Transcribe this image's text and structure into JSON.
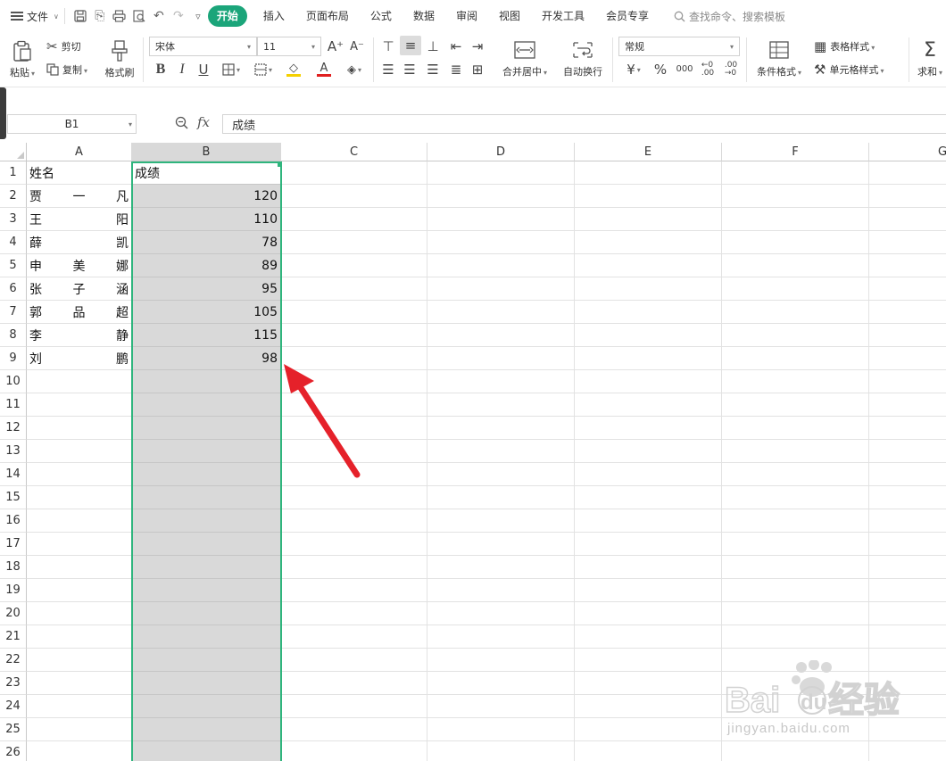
{
  "menubar": {
    "file_label": "文件",
    "tabs": [
      "开始",
      "插入",
      "页面布局",
      "公式",
      "数据",
      "审阅",
      "视图",
      "开发工具",
      "会员专享"
    ],
    "active_tab": "开始",
    "search_placeholder": "查找命令、搜索模板"
  },
  "ribbon": {
    "paste": "粘贴",
    "cut": "剪切",
    "copy": "复制",
    "format_painter": "格式刷",
    "font_name": "宋体",
    "font_size": "11",
    "merge_center": "合并居中",
    "wrap_text": "自动换行",
    "number_format": "常规",
    "conditional_format": "条件格式",
    "table_style": "表格样式",
    "cell_style": "单元格样式",
    "sum": "求和",
    "font_color": "#e02020",
    "fill_color": "#f5d000",
    "brand_color": "#1ba57a"
  },
  "formula_bar": {
    "name_box": "B1",
    "fx": "fx",
    "content": "成绩"
  },
  "sheet": {
    "columns": [
      "A",
      "B",
      "C",
      "D",
      "E",
      "F",
      "G"
    ],
    "selected_column": "B",
    "rows": [
      "1",
      "2",
      "3",
      "4",
      "5",
      "6",
      "7",
      "8",
      "9",
      "10",
      "11",
      "12",
      "13",
      "14",
      "15",
      "16",
      "17",
      "18",
      "19",
      "20",
      "21",
      "22",
      "23",
      "24",
      "25",
      "26"
    ],
    "header": {
      "name": "姓名",
      "score": "成绩"
    },
    "data": [
      {
        "name": [
          "贾",
          "一",
          "凡"
        ],
        "score": "120"
      },
      {
        "name": [
          "王",
          "",
          "阳"
        ],
        "score": "110"
      },
      {
        "name": [
          "薛",
          "",
          "凯"
        ],
        "score": "78"
      },
      {
        "name": [
          "申",
          "美",
          "娜"
        ],
        "score": "89"
      },
      {
        "name": [
          "张",
          "子",
          "涵"
        ],
        "score": "95"
      },
      {
        "name": [
          "郭",
          "品",
          "超"
        ],
        "score": "105"
      },
      {
        "name": [
          "李",
          "",
          "静"
        ],
        "score": "115"
      },
      {
        "name": [
          "刘",
          "",
          "鹏"
        ],
        "score": "98"
      }
    ],
    "selection_color": "#2fb57d"
  },
  "annotation": {
    "arrow_color": "#e5212a"
  },
  "watermark": {
    "logo_text": "Baidu经验",
    "url_text": "jingyan.baidu.com"
  }
}
